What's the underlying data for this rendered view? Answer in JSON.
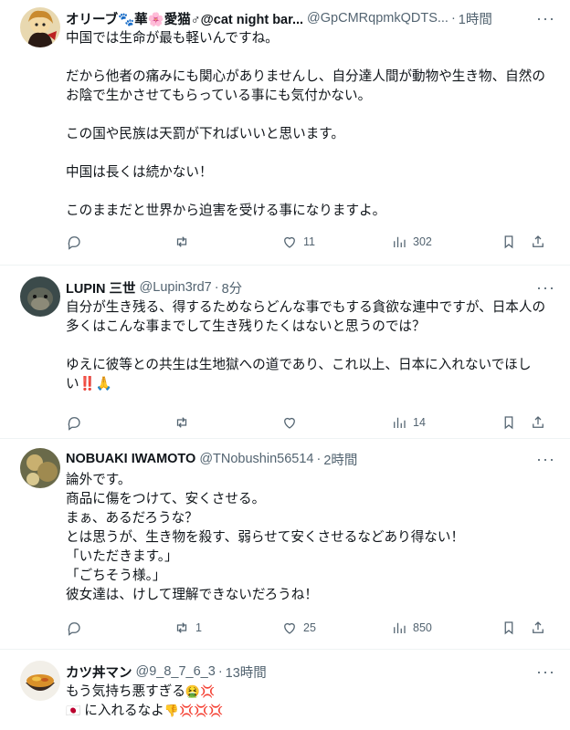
{
  "tweets": [
    {
      "name": "オリーブ🐾華🌸愛猫♂@cat night bar...",
      "handle": "@GpCMRqpmkQDTS...",
      "time": "1時間",
      "body": "中国では生命が最も軽いんですね。\n\nだから他者の痛みにも関心がありませんし、自分達人間が動物や生き物、自然のお陰で生かさせてもらっている事にも気付かない。\n\nこの国や民族は天罰が下ればいいと思います。\n\n中国は長くは続かない！\n\nこのままだと世界から迫害を受ける事になりますよ。",
      "replies": "",
      "retweets": "",
      "likes": "11",
      "views": "302"
    },
    {
      "name": "LUPIN 三世",
      "handle": "@Lupin3rd7",
      "time": "8分",
      "body": "自分が生き残る、得するためならどんな事でもする貪欲な連中ですが、日本人の多くはこんな事までして生き残りたくはないと思うのでは？\n\nゆえに彼等との共生は生地獄への道であり、これ以上、日本に入れないでほしい‼️🙏",
      "replies": "",
      "retweets": "",
      "likes": "",
      "views": "14"
    },
    {
      "name": "NOBUAKI IWAMOTO",
      "handle": "@TNobushin56514",
      "time": "2時間",
      "body": "論外です。\n商品に傷をつけて、安くさせる。\nまぁ、あるだろうな？\nとは思うが、生き物を殺す、弱らせて安くさせるなどあり得ない！\n「いただきます。」\n「ごちそう様。」\n彼女達は、けして理解できないだろうね！",
      "replies": "",
      "retweets": "1",
      "likes": "25",
      "views": "850"
    },
    {
      "name": "カツ丼マン",
      "handle": "@9_8_7_6_3",
      "time": "13時間",
      "line1_text": "もう気持ち悪すぎる",
      "line1_emoji": "🤮💢",
      "line2_flag": "🇯🇵",
      "line2_text": "に入れるなよ",
      "line2_emoji": "👎💢💢💢"
    }
  ],
  "separator": "·",
  "more_label": "···",
  "icons": [
    "reply-icon",
    "retweet-icon",
    "like-icon",
    "views-icon",
    "bookmark-icon",
    "share-icon"
  ]
}
